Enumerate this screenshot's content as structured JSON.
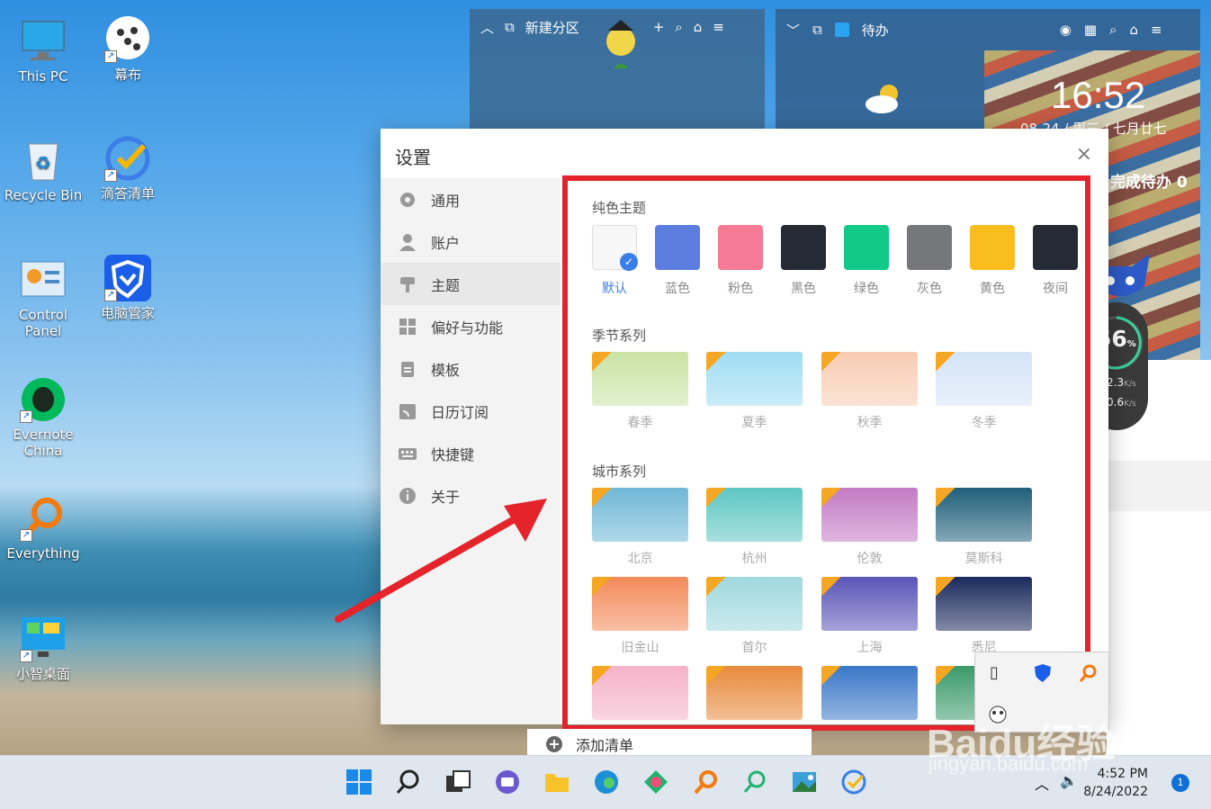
{
  "desktop": {
    "icons": [
      {
        "label": "This PC"
      },
      {
        "label": "幕布"
      },
      {
        "label": "Recycle Bin"
      },
      {
        "label": "滴答清单"
      },
      {
        "label": "Control Panel"
      },
      {
        "label": "电脑管家"
      },
      {
        "label": "Evernote China"
      },
      {
        "label": "Everything"
      },
      {
        "label": "小智桌面"
      }
    ]
  },
  "widget_partition": {
    "title": "新建分区"
  },
  "widget_todo": {
    "title": "待办",
    "time": "16:52",
    "date": "08-24 / 周三 / 七月廿七",
    "complete": "完成待办 0"
  },
  "gauge": {
    "value": "56",
    "unit": "%",
    "up": "2.3",
    "down": "0.6",
    "speed_unit": "K/s"
  },
  "dialog": {
    "title": "设置",
    "close": "×",
    "sidebar": [
      {
        "label": "通用"
      },
      {
        "label": "账户"
      },
      {
        "label": "主题"
      },
      {
        "label": "偏好与功能"
      },
      {
        "label": "模板"
      },
      {
        "label": "日历订阅"
      },
      {
        "label": "快捷键"
      },
      {
        "label": "关于"
      }
    ],
    "solid_title": "纯色主题",
    "solid": [
      {
        "label": "默认",
        "color": "#f7f7f7"
      },
      {
        "label": "蓝色",
        "color": "#5b7ede"
      },
      {
        "label": "粉色",
        "color": "#f47a96"
      },
      {
        "label": "黑色",
        "color": "#262a34"
      },
      {
        "label": "绿色",
        "color": "#13c98a"
      },
      {
        "label": "灰色",
        "color": "#76777b"
      },
      {
        "label": "黄色",
        "color": "#f9bd1e"
      },
      {
        "label": "夜间",
        "color": "#262a34"
      }
    ],
    "season_title": "季节系列",
    "seasons": [
      {
        "label": "春季",
        "color": "#c9e3a4"
      },
      {
        "label": "夏季",
        "color": "#9fdcf2"
      },
      {
        "label": "秋季",
        "color": "#f8cbb2"
      },
      {
        "label": "冬季",
        "color": "#d4e4f7"
      }
    ],
    "city_title": "城市系列",
    "cities": [
      {
        "label": "北京",
        "color": "#6fb7d6"
      },
      {
        "label": "杭州",
        "color": "#5ec6c2"
      },
      {
        "label": "伦敦",
        "color": "#c37ac4"
      },
      {
        "label": "莫斯科",
        "color": "#1f5f7a"
      },
      {
        "label": "旧金山",
        "color": "#f48a5a"
      },
      {
        "label": "首尔",
        "color": "#9fd8de"
      },
      {
        "label": "上海",
        "color": "#5a55b8"
      },
      {
        "label": "悉尼",
        "color": "#1a2a5c"
      },
      {
        "label": "",
        "color": "#f5b2c8"
      },
      {
        "label": "",
        "color": "#e88a3c"
      },
      {
        "label": "",
        "color": "#3a77c8"
      },
      {
        "label": "",
        "color": "#3a9a6a"
      }
    ]
  },
  "add_list": {
    "label": "添加清单"
  },
  "taskbar": {
    "time": "4:52 PM",
    "date": "8/24/2022",
    "badge": "1"
  },
  "watermark": {
    "text": "Baidu经验",
    "sub": "jingyan.baidu.com"
  }
}
